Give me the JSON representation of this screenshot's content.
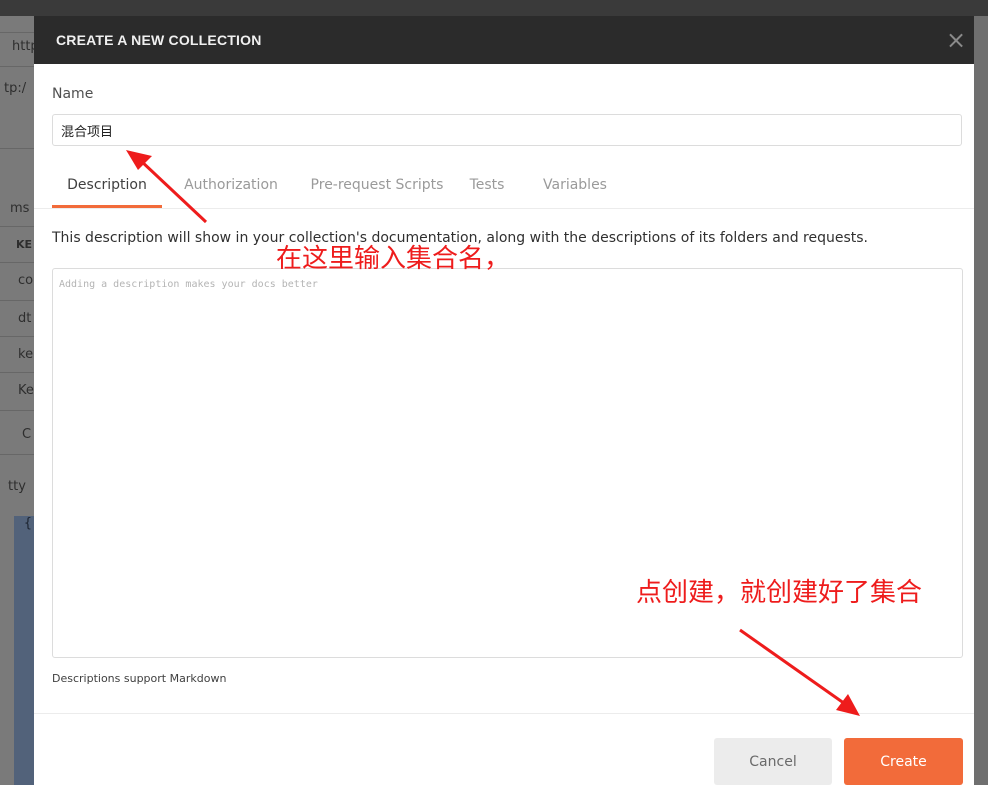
{
  "background_app": {
    "fragments": [
      "http",
      "tp:/",
      "ms",
      "KE",
      "co",
      "dt",
      "ke",
      "Ke",
      "C",
      "tty",
      "{"
    ]
  },
  "modal": {
    "title": "CREATE A NEW COLLECTION",
    "close_glyph": "×",
    "name_label": "Name",
    "name_value": "混合项目",
    "tabs": [
      {
        "label": "Description",
        "active": true
      },
      {
        "label": "Authorization",
        "active": false
      },
      {
        "label": "Pre-request Scripts",
        "active": false
      },
      {
        "label": "Tests",
        "active": false
      },
      {
        "label": "Variables",
        "active": false
      }
    ],
    "description_help": "This description will show in your collection's documentation, along with the descriptions of its folders and requests.",
    "description_placeholder": "Adding a description makes your docs better",
    "markdown_note": "Descriptions support Markdown",
    "cancel_label": "Cancel",
    "create_label": "Create"
  },
  "annotations": {
    "name_hint": "在这里输入集合名，",
    "create_hint": "点创建，就创建好了集合"
  },
  "colors": {
    "accent": "#f26b3a",
    "header_bg": "#2b2b2b",
    "annotation": "#ee1c1c"
  },
  "icons": {
    "close": "close-icon",
    "arrow": "arrow-icon"
  }
}
